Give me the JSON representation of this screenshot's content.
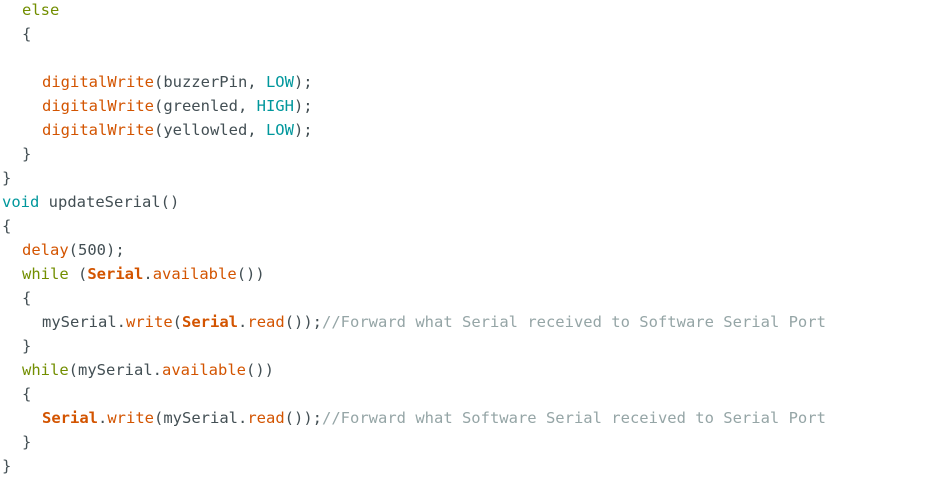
{
  "editor": {
    "lines": [
      {
        "indent": 1,
        "tokens": [
          {
            "t": "else",
            "k": "kw"
          }
        ]
      },
      {
        "indent": 1,
        "tokens": [
          {
            "t": "{",
            "k": "plain"
          }
        ]
      },
      {
        "indent": 0,
        "tokens": []
      },
      {
        "indent": 2,
        "tokens": [
          {
            "t": "digitalWrite",
            "k": "fn"
          },
          {
            "t": "(buzzerPin, ",
            "k": "plain"
          },
          {
            "t": "LOW",
            "k": "const"
          },
          {
            "t": ");",
            "k": "plain"
          }
        ]
      },
      {
        "indent": 2,
        "tokens": [
          {
            "t": "digitalWrite",
            "k": "fn"
          },
          {
            "t": "(greenled, ",
            "k": "plain"
          },
          {
            "t": "HIGH",
            "k": "const"
          },
          {
            "t": ");",
            "k": "plain"
          }
        ]
      },
      {
        "indent": 2,
        "tokens": [
          {
            "t": "digitalWrite",
            "k": "fn"
          },
          {
            "t": "(yellowled, ",
            "k": "plain"
          },
          {
            "t": "LOW",
            "k": "const"
          },
          {
            "t": ");",
            "k": "plain"
          }
        ]
      },
      {
        "indent": 1,
        "tokens": [
          {
            "t": "}",
            "k": "plain"
          }
        ]
      },
      {
        "indent": 0,
        "tokens": [
          {
            "t": "}",
            "k": "plain"
          }
        ]
      },
      {
        "indent": 0,
        "tokens": [
          {
            "t": "void",
            "k": "type"
          },
          {
            "t": " updateSerial()",
            "k": "plain"
          }
        ]
      },
      {
        "indent": 0,
        "tokens": [
          {
            "t": "{",
            "k": "plain"
          }
        ]
      },
      {
        "indent": 1,
        "tokens": [
          {
            "t": "delay",
            "k": "fn"
          },
          {
            "t": "(500);",
            "k": "plain"
          }
        ]
      },
      {
        "indent": 1,
        "tokens": [
          {
            "t": "while",
            "k": "kw"
          },
          {
            "t": " (",
            "k": "plain"
          },
          {
            "t": "Serial",
            "k": "class"
          },
          {
            "t": ".",
            "k": "plain"
          },
          {
            "t": "available",
            "k": "fn"
          },
          {
            "t": "())",
            "k": "plain"
          }
        ]
      },
      {
        "indent": 1,
        "tokens": [
          {
            "t": "{",
            "k": "plain"
          }
        ]
      },
      {
        "indent": 2,
        "tokens": [
          {
            "t": "mySerial.",
            "k": "plain"
          },
          {
            "t": "write",
            "k": "fn"
          },
          {
            "t": "(",
            "k": "plain"
          },
          {
            "t": "Serial",
            "k": "class"
          },
          {
            "t": ".",
            "k": "plain"
          },
          {
            "t": "read",
            "k": "fn"
          },
          {
            "t": "());",
            "k": "plain"
          },
          {
            "t": "//Forward what Serial received to Software Serial Port",
            "k": "comment"
          }
        ]
      },
      {
        "indent": 1,
        "tokens": [
          {
            "t": "}",
            "k": "plain"
          }
        ]
      },
      {
        "indent": 1,
        "tokens": [
          {
            "t": "while",
            "k": "kw"
          },
          {
            "t": "(mySerial.",
            "k": "plain"
          },
          {
            "t": "available",
            "k": "fn"
          },
          {
            "t": "())",
            "k": "plain"
          }
        ]
      },
      {
        "indent": 1,
        "tokens": [
          {
            "t": "{",
            "k": "plain"
          }
        ]
      },
      {
        "indent": 2,
        "tokens": [
          {
            "t": "Serial",
            "k": "class"
          },
          {
            "t": ".",
            "k": "plain"
          },
          {
            "t": "write",
            "k": "fn"
          },
          {
            "t": "(mySerial.",
            "k": "plain"
          },
          {
            "t": "read",
            "k": "fn"
          },
          {
            "t": "());",
            "k": "plain"
          },
          {
            "t": "//Forward what Software Serial received to Serial Port",
            "k": "comment"
          }
        ]
      },
      {
        "indent": 1,
        "tokens": [
          {
            "t": "}",
            "k": "plain"
          }
        ]
      },
      {
        "indent": 0,
        "tokens": [
          {
            "t": "}",
            "k": "plain"
          }
        ]
      }
    ]
  }
}
